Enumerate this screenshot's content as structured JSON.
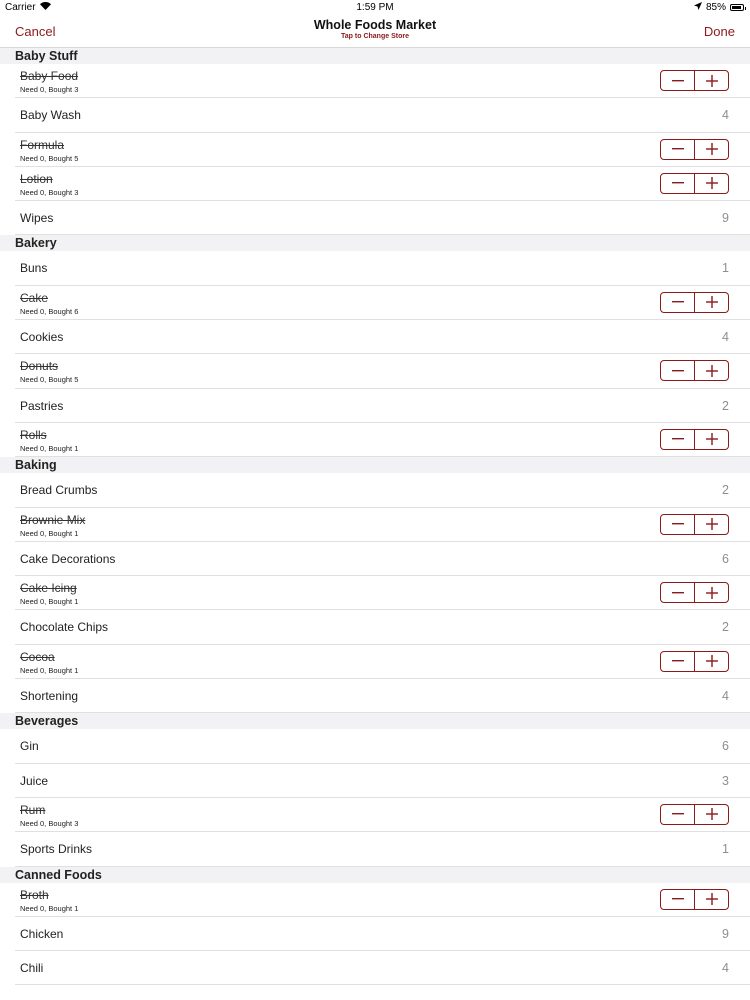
{
  "status": {
    "carrier": "Carrier",
    "time": "1:59 PM",
    "battery": "85%",
    "battery_level": 0.85
  },
  "nav": {
    "cancel": "Cancel",
    "title": "Whole Foods Market",
    "subtitle": "Tap to Change Store",
    "done": "Done"
  },
  "accent_color": "#8b1a1a",
  "sections": [
    {
      "title": "Baby Stuff",
      "items": [
        {
          "name": "Baby Food",
          "bought": true,
          "sub": "Need 0, Bought 3"
        },
        {
          "name": "Baby Wash",
          "bought": false,
          "count": "4"
        },
        {
          "name": "Formula",
          "bought": true,
          "sub": "Need 0, Bought 5"
        },
        {
          "name": "Lotion",
          "bought": true,
          "sub": "Need 0, Bought 3"
        },
        {
          "name": "Wipes",
          "bought": false,
          "count": "9"
        }
      ]
    },
    {
      "title": "Bakery",
      "items": [
        {
          "name": "Buns",
          "bought": false,
          "count": "1"
        },
        {
          "name": "Cake",
          "bought": true,
          "sub": "Need 0, Bought 6"
        },
        {
          "name": "Cookies",
          "bought": false,
          "count": "4"
        },
        {
          "name": "Donuts",
          "bought": true,
          "sub": "Need 0, Bought 5"
        },
        {
          "name": "Pastries",
          "bought": false,
          "count": "2"
        },
        {
          "name": "Rolls",
          "bought": true,
          "sub": "Need 0, Bought 1"
        }
      ]
    },
    {
      "title": "Baking",
      "items": [
        {
          "name": "Bread Crumbs",
          "bought": false,
          "count": "2"
        },
        {
          "name": "Brownie Mix",
          "bought": true,
          "sub": "Need 0, Bought 1"
        },
        {
          "name": "Cake Decorations",
          "bought": false,
          "count": "6"
        },
        {
          "name": "Cake Icing",
          "bought": true,
          "sub": "Need 0, Bought 1"
        },
        {
          "name": "Chocolate Chips",
          "bought": false,
          "count": "2"
        },
        {
          "name": "Cocoa",
          "bought": true,
          "sub": "Need 0, Bought 1"
        },
        {
          "name": "Shortening",
          "bought": false,
          "count": "4"
        }
      ]
    },
    {
      "title": "Beverages",
      "items": [
        {
          "name": "Gin",
          "bought": false,
          "count": "6"
        },
        {
          "name": "Juice",
          "bought": false,
          "count": "3"
        },
        {
          "name": "Rum",
          "bought": true,
          "sub": "Need 0, Bought 3"
        },
        {
          "name": "Sports Drinks",
          "bought": false,
          "count": "1"
        }
      ]
    },
    {
      "title": "Canned Foods",
      "items": [
        {
          "name": "Broth",
          "bought": true,
          "sub": "Need 0, Bought 1"
        },
        {
          "name": "Chicken",
          "bought": false,
          "count": "9"
        },
        {
          "name": "Chili",
          "bought": false,
          "count": "4"
        }
      ]
    }
  ]
}
